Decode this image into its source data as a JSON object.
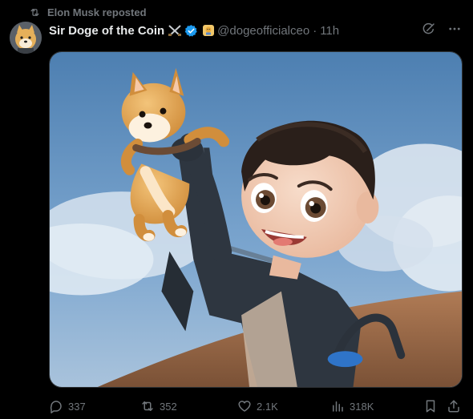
{
  "repost": {
    "text": "Elon Musk reposted",
    "icon": "repost-icon"
  },
  "author": {
    "name": "Sir Doge of the Coin",
    "name_emoji": "crossed-swords-icon",
    "verified": "verified-badge-icon",
    "affiliate": "affiliate-badge-icon",
    "handle": "@dogeofficialceo",
    "separator": "·",
    "time": "11h"
  },
  "header_icons": [
    "grok-icon",
    "more-icon"
  ],
  "media": {
    "type": "image",
    "alt": "3D animated character holding up a Shiba Inu dog against a blue sky"
  },
  "stats": {
    "replies": "337",
    "reposts": "352",
    "likes": "2.1K",
    "views": "318K"
  },
  "colors": {
    "background": "#000000",
    "text": "#e7e9ea",
    "muted": "#71767b",
    "verified": "#1d9bf0"
  }
}
